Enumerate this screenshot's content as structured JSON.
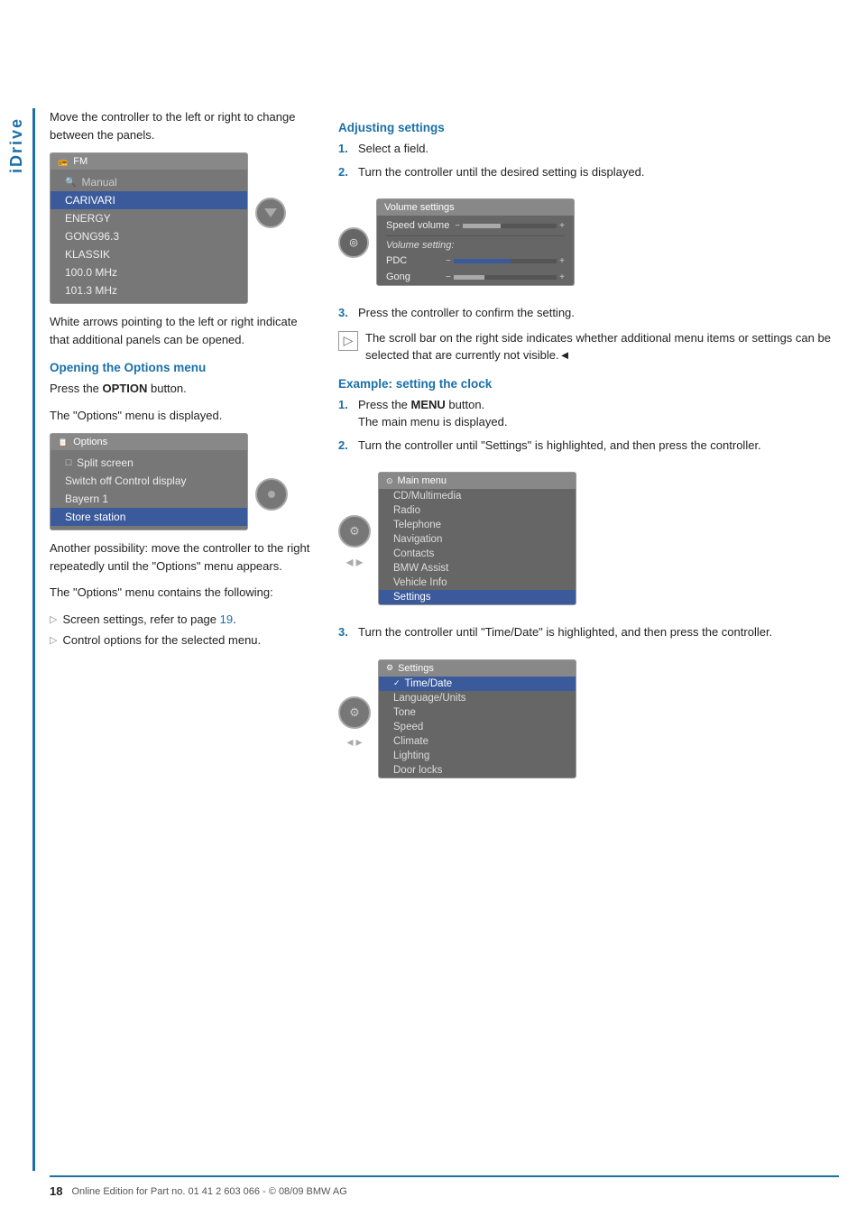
{
  "sidebar": {
    "label": "iDrive"
  },
  "left_col": {
    "intro_text": "Move the controller to the left or right to change between the panels.",
    "fm_screen": {
      "header": "FM",
      "rows": [
        "Manual",
        "CARIVARI",
        "ENERGY",
        "GONG96.3",
        "KLASSIK",
        "100.0 MHz",
        "101.3 MHz"
      ]
    },
    "white_arrows_text": "White arrows pointing to the left or right indicate that additional panels can be opened.",
    "options_section": {
      "title": "Opening the Options menu",
      "para1": "Press the OPTION button.",
      "para2": "The \"Options\" menu is displayed.",
      "options_screen": {
        "header": "Options",
        "rows": [
          "Split screen",
          "Switch off Control display",
          "Bayern 1",
          "Store station"
        ]
      },
      "para3": "Another possibility: move the controller to the right repeatedly until the \"Options\" menu appears.",
      "para4": "The \"Options\" menu contains the following:",
      "bullets": [
        "Screen settings, refer to page 19.",
        "Control options for the selected menu."
      ]
    }
  },
  "right_col": {
    "adjusting_section": {
      "title": "Adjusting settings",
      "steps": [
        {
          "num": "1.",
          "text": "Select a field."
        },
        {
          "num": "2.",
          "text": "Turn the controller until the desired setting is displayed."
        }
      ],
      "vol_screen": {
        "header": "Volume settings",
        "speed_volume_label": "Speed volume",
        "volume_setting_label": "Volume setting:",
        "rows": [
          {
            "label": "PDC",
            "minus": "-",
            "plus": "+"
          },
          {
            "label": "Gong",
            "minus": "-",
            "plus": "+"
          }
        ]
      },
      "step3": {
        "num": "3.",
        "text": "Press the controller to confirm the setting."
      },
      "scroll_note": "The scroll bar on the right side indicates whether additional menu items or settings can be selected that are currently not visible."
    },
    "example_section": {
      "title": "Example: setting the clock",
      "steps": [
        {
          "num": "1.",
          "text": "Press the MENU button.\nThe main menu is displayed."
        },
        {
          "num": "2.",
          "text": "Turn the controller until \"Settings\" is highlighted, and then press the controller."
        }
      ],
      "main_menu_screen": {
        "header": "Main menu",
        "rows": [
          "CD/Multimedia",
          "Radio",
          "Telephone",
          "Navigation",
          "Contacts",
          "BMW Assist",
          "Vehicle Info",
          "Settings"
        ]
      },
      "step3": {
        "num": "3.",
        "text": "Turn the controller until \"Time/Date\" is highlighted, and then press the controller."
      },
      "settings_screen": {
        "header": "Settings",
        "rows": [
          "Time/Date",
          "Language/Units",
          "Tone",
          "Speed",
          "Climate",
          "Lighting",
          "Door locks"
        ]
      }
    }
  },
  "footer": {
    "page_number": "18",
    "footer_text": "Online Edition for Part no. 01 41 2 603 066 - © 08/09 BMW AG"
  },
  "labels": {
    "option_bold": "OPTION",
    "menu_bold": "MENU",
    "page_link": "19"
  }
}
